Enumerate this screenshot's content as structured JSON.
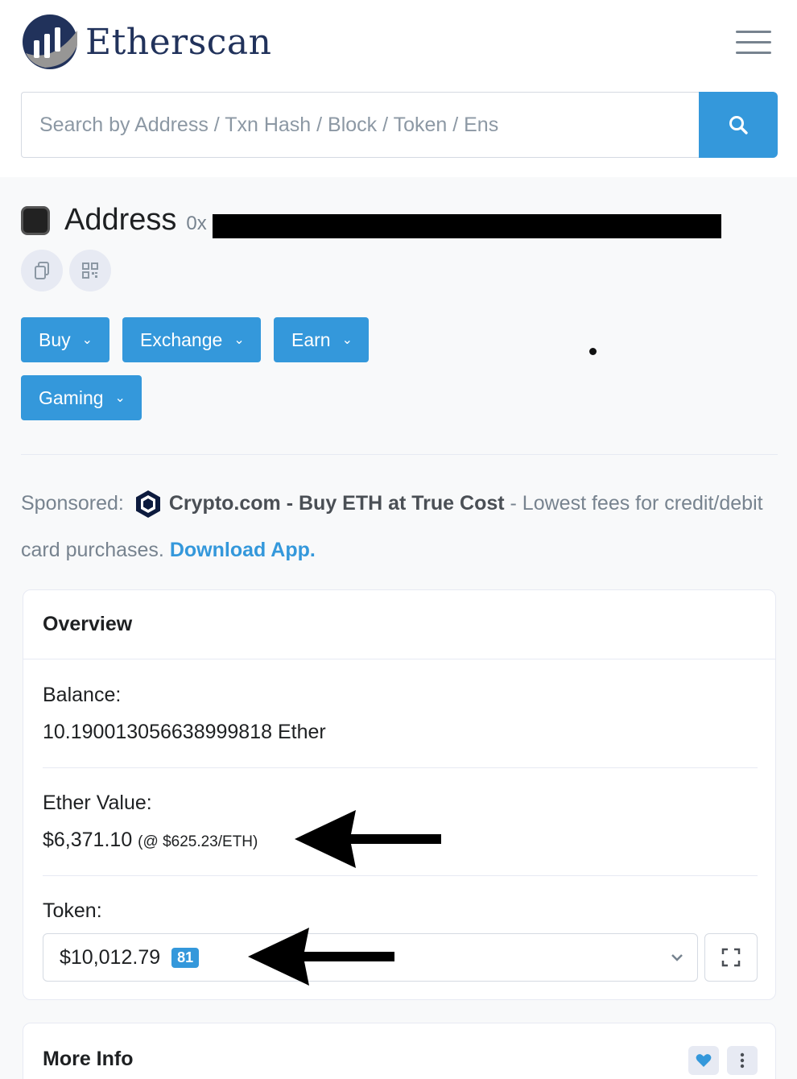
{
  "header": {
    "brand": "Etherscan",
    "search": {
      "placeholder": "Search by Address / Txn Hash / Block / Token / Ens",
      "value": ""
    }
  },
  "address": {
    "label": "Address",
    "prefix": "0x"
  },
  "actions": [
    "Buy",
    "Exchange",
    "Earn",
    "Gaming"
  ],
  "sponsor": {
    "label": "Sponsored:",
    "brand_text": "Crypto.com - Buy ETH at True Cost",
    "description": " - Lowest fees for credit/debit card purchases. ",
    "link": "Download App."
  },
  "overview": {
    "title": "Overview",
    "balance_label": "Balance:",
    "balance_value": "10.190013056638999818 Ether",
    "ether_value_label": "Ether Value:",
    "ether_value": "$6,371.10",
    "ether_price": "(@ $625.23/ETH)",
    "token_label": "Token:",
    "token_value": "$10,012.79",
    "token_count": "81"
  },
  "more_info": {
    "title": "More Info"
  },
  "colors": {
    "accent": "#3498db",
    "brand_dark": "#21325b"
  }
}
